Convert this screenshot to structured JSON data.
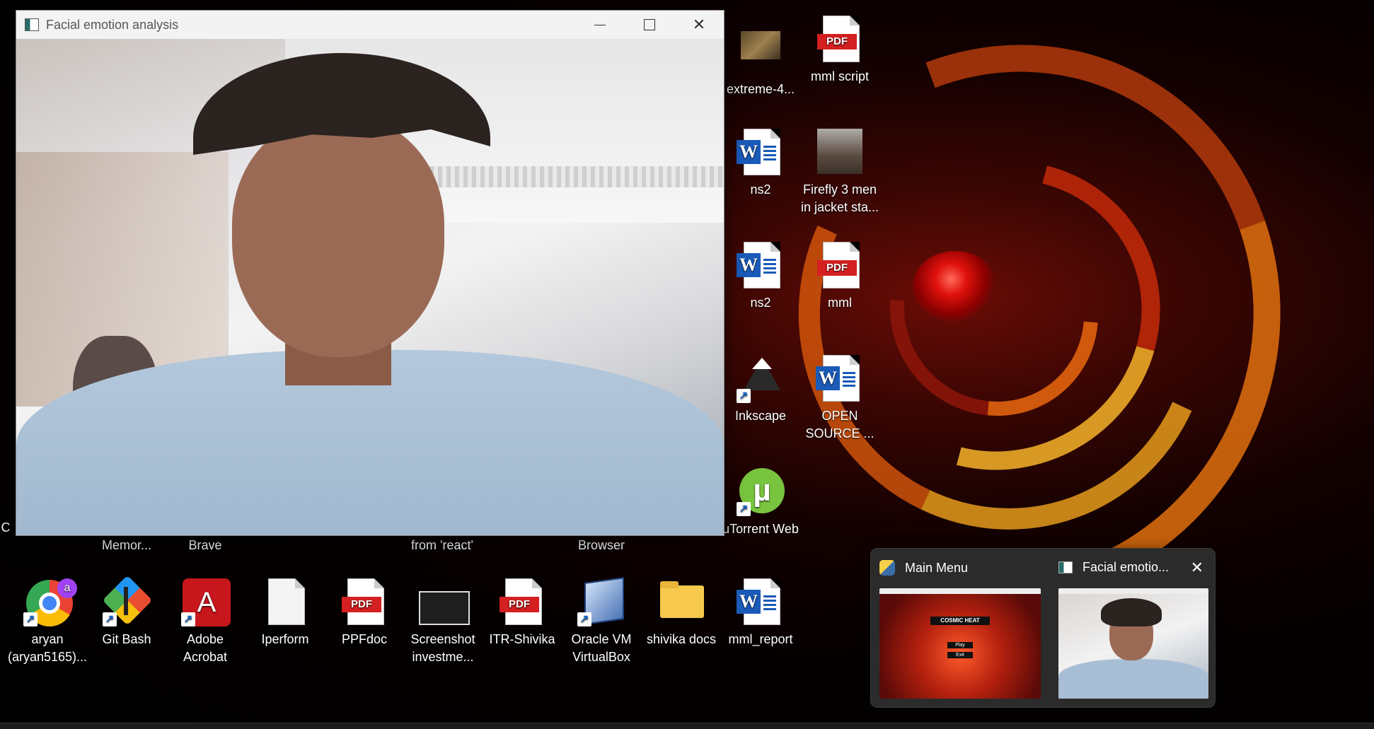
{
  "window": {
    "title": "Facial emotion analysis",
    "minimize_icon": "minimize-icon",
    "maximize_icon": "maximize-icon",
    "close_icon": "close-icon"
  },
  "desktop_right_icons": [
    {
      "label": "extreme-4...",
      "icon": "image-thumbnail-icon"
    },
    {
      "label": "mml script",
      "icon": "pdf-icon"
    },
    {
      "label": "ns2",
      "icon": "word-document-icon"
    },
    {
      "label": "Firefly 3 men in jacket sta...",
      "icon": "image-thumbnail-icon"
    },
    {
      "label": "ns2",
      "icon": "word-icon"
    },
    {
      "label": "mml",
      "icon": "pdf-icon"
    },
    {
      "label": "Inkscape",
      "icon": "inkscape-icon"
    },
    {
      "label": "OPEN SOURCE ...",
      "icon": "word-icon"
    },
    {
      "label": "uTorrent Web",
      "icon": "utorrent-icon"
    }
  ],
  "desktop_partial_labels": [
    "C",
    "Memor...",
    "Brave",
    "from 'react'",
    "Browser"
  ],
  "desktop_bottom_icons": [
    {
      "label": "aryan (aryan5165)...",
      "icon": "chrome-icon",
      "badge": "a"
    },
    {
      "label": "Git Bash",
      "icon": "git-bash-icon"
    },
    {
      "label": "Adobe Acrobat",
      "icon": "adobe-acrobat-icon"
    },
    {
      "label": "Iperform",
      "icon": "text-file-icon"
    },
    {
      "label": "PPFdoc",
      "icon": "pdf-icon"
    },
    {
      "label": "Screenshot investme...",
      "icon": "screenshot-thumbnail-icon"
    },
    {
      "label": "ITR-Shivika",
      "icon": "pdf-icon"
    },
    {
      "label": "Oracle VM VirtualBox",
      "icon": "virtualbox-icon"
    },
    {
      "label": "shivika docs",
      "icon": "folder-icon"
    },
    {
      "label": "mml_report",
      "icon": "word-icon"
    }
  ],
  "pdf_badge_text": "PDF",
  "word_badge_text": "W",
  "taskbar_preview": {
    "items": [
      {
        "title": "Main Menu",
        "icon": "python-icon",
        "game_title": "COSMIC HEAT",
        "menu": [
          "Play",
          "Exit"
        ]
      },
      {
        "title": "Facial emotio...",
        "icon": "app-window-icon"
      }
    ],
    "close_icon": "close-icon"
  }
}
